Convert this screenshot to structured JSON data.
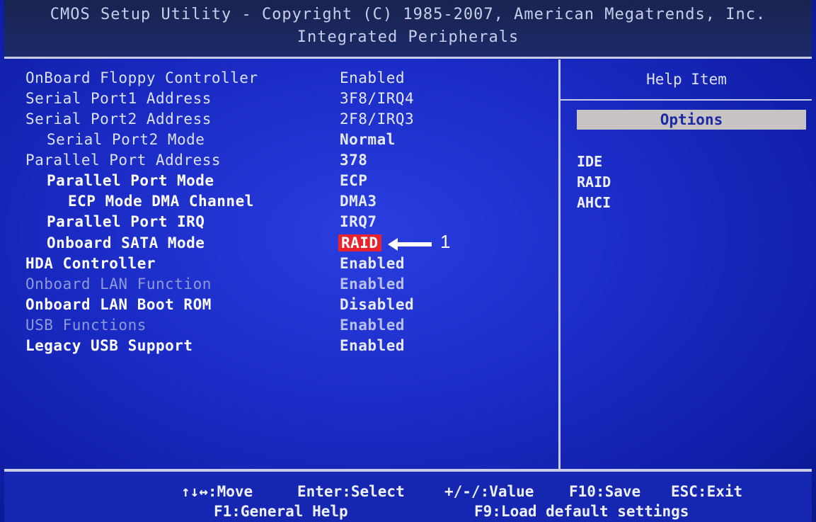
{
  "header": {
    "line1": "CMOS Setup Utility - Copyright (C) 1985-2007, American Megatrends, Inc.",
    "line2": "Integrated Peripherals"
  },
  "settings": [
    {
      "label": "OnBoard Floppy Controller",
      "value": "Enabled"
    },
    {
      "label": "Serial Port1 Address",
      "value": "3F8/IRQ4"
    },
    {
      "label": "Serial Port2 Address",
      "value": "2F8/IRQ3"
    },
    {
      "label": "Serial Port2 Mode",
      "value": "Normal"
    },
    {
      "label": "Parallel Port Address",
      "value": "378"
    },
    {
      "label": "Parallel Port Mode",
      "value": "ECP"
    },
    {
      "label": "ECP Mode DMA Channel",
      "value": "DMA3"
    },
    {
      "label": "Parallel Port IRQ",
      "value": "IRQ7"
    },
    {
      "label": "Onboard SATA Mode",
      "value": "RAID"
    },
    {
      "label": "HDA Controller",
      "value": "Enabled"
    },
    {
      "label": "Onboard LAN Function",
      "value": "Enabled"
    },
    {
      "label": "Onboard LAN Boot ROM",
      "value": "Disabled"
    },
    {
      "label": "USB Functions",
      "value": "Enabled"
    },
    {
      "label": "Legacy USB Support",
      "value": "Enabled"
    }
  ],
  "help": {
    "title": "Help Item",
    "options_label": "Options",
    "options": [
      "IDE",
      "RAID",
      "AHCI"
    ]
  },
  "annotation": {
    "label": "1"
  },
  "footer": {
    "move": "↑↓↔:Move",
    "select": "Enter:Select",
    "value": "+/-/:Value",
    "save": "F10:Save",
    "exit": "ESC:Exit",
    "help": "F1:General Help",
    "defaults": "F9:Load default settings"
  },
  "colors": {
    "background": "#1a2bc4",
    "selected_highlight": "#e8232b",
    "options_box": "#c8c4c4"
  }
}
